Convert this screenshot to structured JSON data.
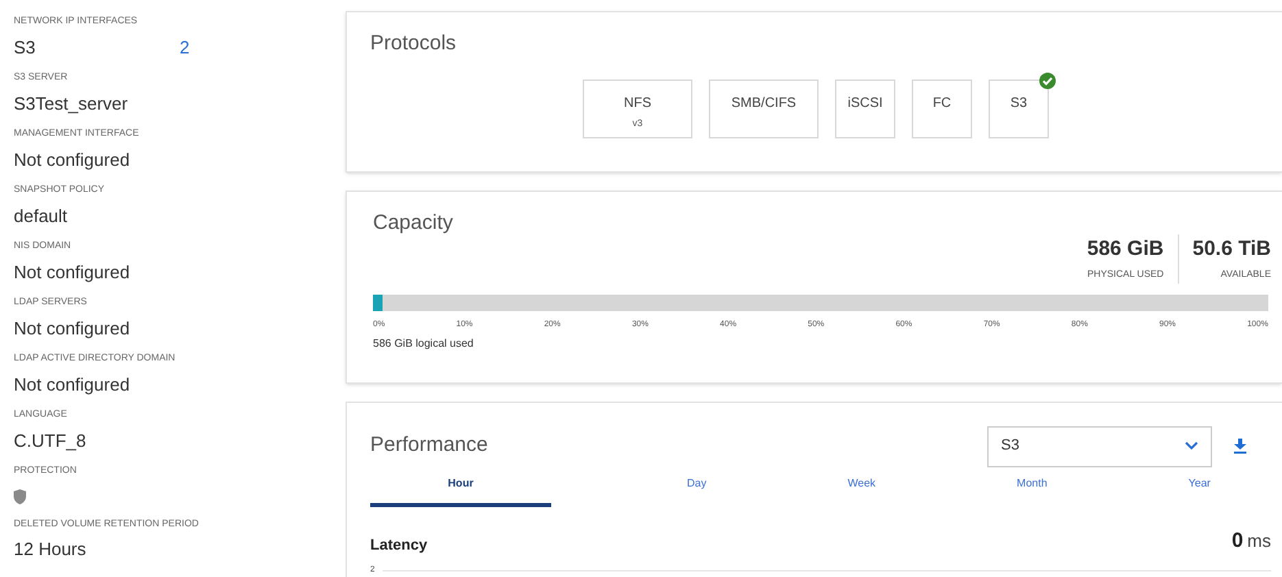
{
  "details": [
    {
      "label": "NETWORK IP INTERFACES",
      "value": "S3",
      "count": "2"
    },
    {
      "label": "S3 SERVER",
      "value": "S3Test_server"
    },
    {
      "label": "MANAGEMENT INTERFACE",
      "value": "Not configured"
    },
    {
      "label": "SNAPSHOT POLICY",
      "value": "default"
    },
    {
      "label": "NIS DOMAIN",
      "value": "Not configured"
    },
    {
      "label": "LDAP SERVERS",
      "value": "Not configured"
    },
    {
      "label": "LDAP ACTIVE DIRECTORY DOMAIN",
      "value": "Not configured"
    },
    {
      "label": "LANGUAGE",
      "value": "C.UTF_8"
    },
    {
      "label": "PROTECTION",
      "kind": "shield"
    },
    {
      "label": "DELETED VOLUME RETENTION PERIOD",
      "value": "12 Hours"
    }
  ],
  "protocols": {
    "title": "Protocols",
    "items": [
      {
        "name": "NFS",
        "version": "v3",
        "enabled": false
      },
      {
        "name": "SMB/CIFS",
        "enabled": false
      },
      {
        "name": "iSCSI",
        "enabled": false
      },
      {
        "name": "FC",
        "enabled": false
      },
      {
        "name": "S3",
        "enabled": true
      }
    ]
  },
  "capacity": {
    "title": "Capacity",
    "stats": [
      {
        "value": "586 GiB",
        "label": "PHYSICAL USED"
      },
      {
        "value": "50.6 TiB",
        "label": "AVAILABLE"
      }
    ],
    "level": 0.011,
    "ticks": [
      "0%",
      "10%",
      "20%",
      "30%",
      "40%",
      "50%",
      "60%",
      "70%",
      "80%",
      "90%",
      "100%"
    ],
    "note": "586 GiB logical used"
  },
  "performance": {
    "title": "Performance",
    "dropdown": "S3",
    "tabs": [
      {
        "label": "Hour",
        "selected": true
      },
      {
        "label": "Day",
        "selected": false
      },
      {
        "label": "Week",
        "selected": false
      },
      {
        "label": "Month",
        "selected": false
      },
      {
        "label": "Year",
        "selected": false
      }
    ],
    "metric": "Latency",
    "reading": "0",
    "unit": "ms",
    "axis_tick": "2"
  }
}
